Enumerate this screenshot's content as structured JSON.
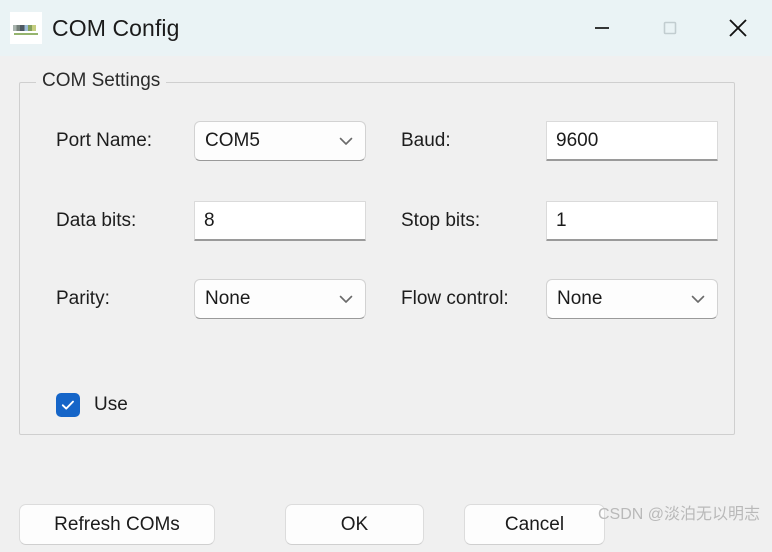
{
  "window": {
    "title": "COM Config",
    "icon": "app-icon",
    "controls": {
      "minimize": "minimize-icon",
      "maximize": "maximize-icon",
      "close": "close-icon"
    }
  },
  "groupbox": {
    "legend": "COM Settings"
  },
  "fields": {
    "port_name": {
      "label": "Port Name:",
      "value": "COM5",
      "type": "combobox"
    },
    "baud": {
      "label": "Baud:",
      "value": "9600",
      "type": "textfield"
    },
    "data_bits": {
      "label": "Data bits:",
      "value": "8",
      "type": "textfield"
    },
    "stop_bits": {
      "label": "Stop bits:",
      "value": "1",
      "type": "textfield"
    },
    "parity": {
      "label": "Parity:",
      "value": "None",
      "type": "combobox"
    },
    "flow_control": {
      "label": "Flow control:",
      "value": "None",
      "type": "combobox"
    }
  },
  "use_checkbox": {
    "label": "Use",
    "checked": true,
    "accent_color": "#1565c8"
  },
  "buttons": {
    "refresh": "Refresh COMs",
    "ok": "OK",
    "cancel": "Cancel"
  },
  "watermark": {
    "text": "CSDN @淡泊无以明志"
  },
  "colors": {
    "titlebar_bg": "#eaf3f5",
    "body_bg": "#f0f0f0",
    "text": "#1b1b1b",
    "border": "#cfcfcf",
    "accent": "#1565c8"
  }
}
